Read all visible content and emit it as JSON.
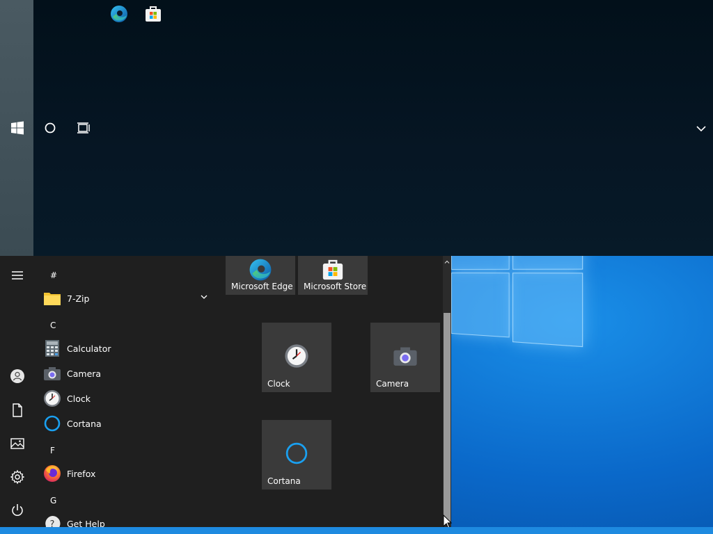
{
  "taskbar": {
    "pinned": [
      {
        "icon": "edge-icon",
        "name": "Microsoft Edge"
      },
      {
        "icon": "store-icon",
        "name": "Microsoft Store"
      }
    ],
    "buttons": [
      {
        "icon": "windows-start-icon"
      },
      {
        "icon": "cortana-search-icon"
      },
      {
        "icon": "task-view-icon"
      }
    ],
    "overflow_icon": "chevron-down-icon"
  },
  "start_menu": {
    "sidebar": [
      "hamburger-menu-icon",
      "user-account-icon",
      "documents-icon",
      "pictures-icon",
      "settings-gear-icon",
      "power-icon"
    ],
    "app_list": {
      "groups": [
        {
          "letter": "#",
          "apps": [
            {
              "label": "7-Zip",
              "icon": "folder-icon"
            }
          ]
        },
        {
          "letter": "C",
          "apps": [
            {
              "label": "Calculator",
              "icon": "calculator-icon"
            },
            {
              "label": "Camera",
              "icon": "camera-icon"
            },
            {
              "label": "Clock",
              "icon": "clock-icon"
            },
            {
              "label": "Cortana",
              "icon": "cortana-icon"
            }
          ]
        },
        {
          "letter": "F",
          "apps": [
            {
              "label": "Firefox",
              "icon": "firefox-icon"
            }
          ]
        },
        {
          "letter": "G",
          "apps": [
            {
              "label": "Get Help",
              "icon": "get-help-icon"
            }
          ]
        }
      ]
    },
    "tiles": [
      {
        "label": "Microsoft Edge",
        "icon": "edge-icon"
      },
      {
        "label": "Microsoft Store",
        "icon": "store-icon"
      },
      {
        "label": "Clock",
        "icon": "clock-icon"
      },
      {
        "label": "Camera",
        "icon": "camera-icon"
      },
      {
        "label": "Cortana",
        "icon": "cortana-icon"
      }
    ]
  },
  "colors": {
    "menu_bg": "#1f1f1f",
    "tile_bg": "#3a3a3a",
    "accent": "#0078d7",
    "desktop_blue": "#0a68c9"
  }
}
